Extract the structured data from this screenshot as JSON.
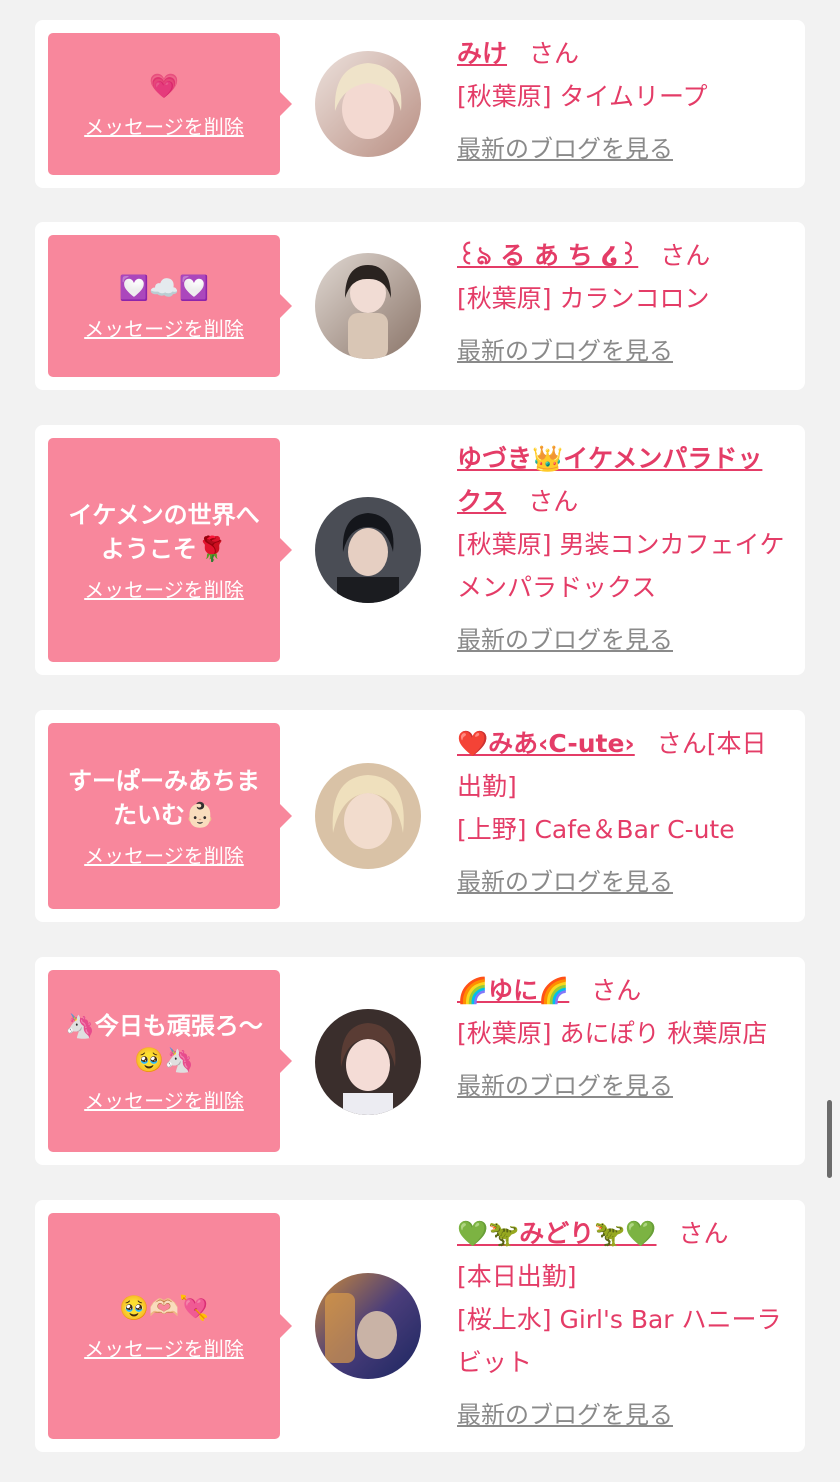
{
  "cards": [
    {
      "message": "💗",
      "delete_label": "メッセージを削除",
      "name": "みけ",
      "honorific": "さん",
      "extra": "",
      "shop": "[秋葉原] タイムリープ",
      "blog_label": "最新のブログを見る",
      "avatar_colors": [
        "#e9ddd8",
        "#c9a89a"
      ]
    },
    {
      "message": "💟☁️💟",
      "delete_label": "メッセージを削除",
      "name": "꒰ঌ る あ ち ໒꒱",
      "honorific": "さん",
      "extra": "",
      "shop": "[秋葉原] カランコロン",
      "blog_label": "最新のブログを見る",
      "avatar_colors": [
        "#d8cfc8",
        "#7a6258"
      ]
    },
    {
      "message": "イケメンの世界へ\nようこそ🌹",
      "delete_label": "メッセージを削除",
      "name": "ゆづき👑イケメンパラドックス",
      "honorific": "さん",
      "extra": "",
      "shop": "[秋葉原] 男装コンカフェイケメンパラドックス",
      "blog_label": "最新のブログを見る",
      "avatar_colors": [
        "#3a3d45",
        "#d8c2b4"
      ]
    },
    {
      "message": "すーぱーみあちま\nたいむ👶🏻",
      "delete_label": "メッセージを削除",
      "name": "❤️みあ‹C-ute›",
      "honorific": "さん",
      "extra": "[本日出勤]",
      "shop": "[上野] Cafe＆Bar C-ute",
      "blog_label": "最新のブログを見る",
      "avatar_colors": [
        "#e8d4b8",
        "#bfa184"
      ]
    },
    {
      "message": "🦄今日も頑張ろ〜\n🥹🦄",
      "delete_label": "メッセージを削除",
      "name": "🌈ゆに🌈",
      "honorific": "さん",
      "extra": "",
      "shop": "[秋葉原] あにぽり 秋葉原店",
      "blog_label": "最新のブログを見る",
      "avatar_colors": [
        "#3b2f2f",
        "#f0d6d0"
      ]
    },
    {
      "message": "🥹🫶🏻💘",
      "delete_label": "メッセージを削除",
      "name": "💚🦖みどり🦖💚",
      "honorific": "さん",
      "extra": "[本日出勤]",
      "shop": "[桜上水] Girl's Bar ハニーラビット",
      "blog_label": "最新のブログを見る",
      "avatar_colors": [
        "#2a3570",
        "#d48a3c"
      ]
    }
  ]
}
